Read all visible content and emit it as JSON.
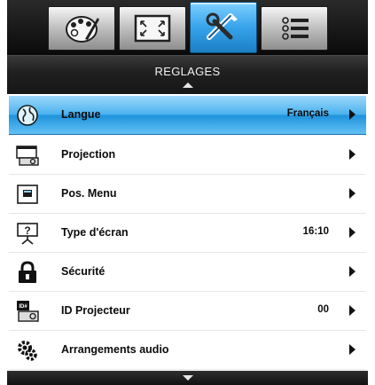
{
  "tabs": [
    {
      "icon": "palette-icon"
    },
    {
      "icon": "screen-resize-icon"
    },
    {
      "icon": "tools-icon"
    },
    {
      "icon": "options-list-icon"
    }
  ],
  "active_tab": 2,
  "title": "REGLAGES",
  "items": [
    {
      "label": "Langue",
      "value": "Français",
      "icon": "globe-icon"
    },
    {
      "label": "Projection",
      "value": "",
      "icon": "projection-icon"
    },
    {
      "label": "Pos. Menu",
      "value": "",
      "icon": "menu-position-icon"
    },
    {
      "label": "Type d'écran",
      "value": "16:10",
      "icon": "screen-type-icon"
    },
    {
      "label": "Sécurité",
      "value": "",
      "icon": "lock-icon"
    },
    {
      "label": "ID Projecteur",
      "value": "00",
      "icon": "projector-id-icon"
    },
    {
      "label": "Arrangements audio",
      "value": "",
      "icon": "audio-settings-icon"
    }
  ],
  "colors": {
    "selected_row": "#4bb3ef",
    "header_bg": "#1b1b1b",
    "text": "#0b0b0b"
  }
}
